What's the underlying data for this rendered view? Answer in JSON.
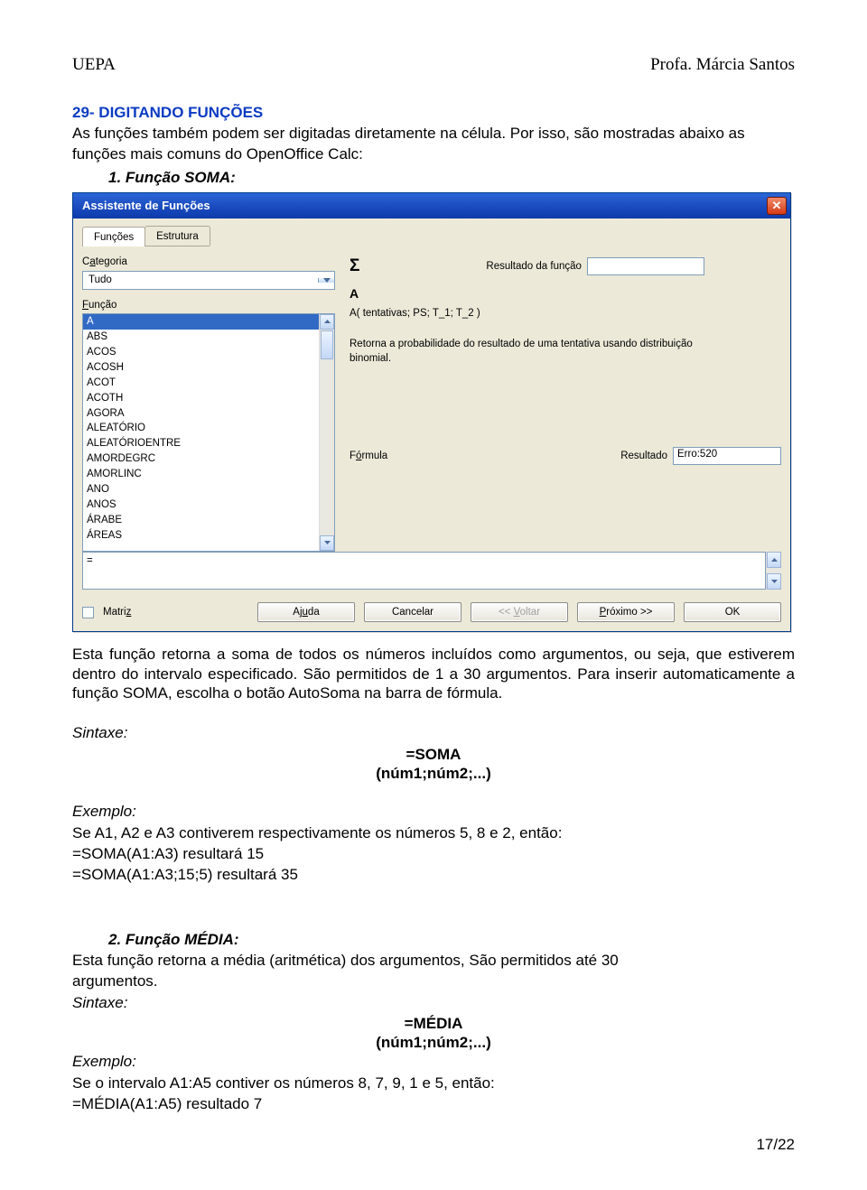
{
  "header": {
    "left": "UEPA",
    "right": "Profa. Márcia Santos"
  },
  "section_title": "29- DIGITANDO FUNÇÕES",
  "intro_line1": "As funções também podem ser digitadas diretamente na célula. Por isso, são mostradas abaixo as",
  "intro_line2": "funções mais comuns do OpenOffice Calc:",
  "item1": {
    "num": "1.",
    "title": "Função SOMA:"
  },
  "dialog": {
    "title": "Assistente de Funções",
    "tabs": [
      "Funções",
      "Estrutura"
    ],
    "sigma": "Σ",
    "resultado_label": "Resultado da função",
    "categoria_label_pre": "C",
    "categoria_label_key": "a",
    "categoria_label_post": "tegoria",
    "categoria_value": "Tudo",
    "funcao_label_key": "F",
    "funcao_label_post": "unção",
    "list": [
      "A",
      "ABS",
      "ACOS",
      "ACOSH",
      "ACOT",
      "ACOTH",
      "AGORA",
      "ALEATÓRIO",
      "ALEATÓRIOENTRE",
      "AMORDEGRC",
      "AMORLINC",
      "ANO",
      "ANOS",
      "ÁRABE",
      "ÁREAS"
    ],
    "fn_name": "A",
    "fn_sig": "A( tentativas; PS; T_1; T_2 )",
    "fn_desc1": "Retorna a probabilidade do resultado de uma tentativa usando distribuição",
    "fn_desc2": "binomial.",
    "formula_label_key": "F",
    "formula_label_post_u": "ó",
    "formula_label_post": "rmula",
    "formula_value": "=",
    "resultado2_label": "Resultado",
    "resultado2_value": "Erro:520",
    "matrix_label": "Matri",
    "matrix_key": "z",
    "buttons": {
      "help_pre": "Aj",
      "help_key": "u",
      "help_post": "da",
      "cancel": "Cancelar",
      "back": "<<",
      "back_key": "V",
      "back_post": "oltar",
      "next_key": "P",
      "next_post": "róximo >>",
      "ok": "OK"
    }
  },
  "after_img_p1": "Esta função retorna a soma de todos os números incluídos como argumentos, ou seja, que estiverem dentro do intervalo especificado. São permitidos de 1 a 30 argumentos. Para inserir automaticamente a função SOMA, escolha o botão AutoSoma na barra de fórmula.",
  "sintaxe_label": "Sintaxe:",
  "syntax1_line1": "=SOMA",
  "syntax1_line2": "(núm1;núm2;...)",
  "exemplo_label": "Exemplo:",
  "exemplo1_l1": "Se A1, A2 e A3 contiverem respectivamente os números 5, 8 e 2, então:",
  "exemplo1_l2": "=SOMA(A1:A3) resultará 15",
  "exemplo1_l3": "=SOMA(A1:A3;15;5) resultará 35",
  "item2": {
    "num": "2.",
    "title": "Função MÉDIA:"
  },
  "media_p1": "Esta função retorna a média (aritmética) dos argumentos, São permitidos até 30",
  "media_p2": "argumentos.",
  "syntax2_line1": "=MÉDIA",
  "syntax2_line2": "(núm1;núm2;...)",
  "exemplo2_l1": "Se o intervalo A1:A5 contiver os números 8, 7, 9, 1 e 5, então:",
  "exemplo2_l2": "=MÉDIA(A1:A5) resultado 7",
  "page_number": "17/22"
}
